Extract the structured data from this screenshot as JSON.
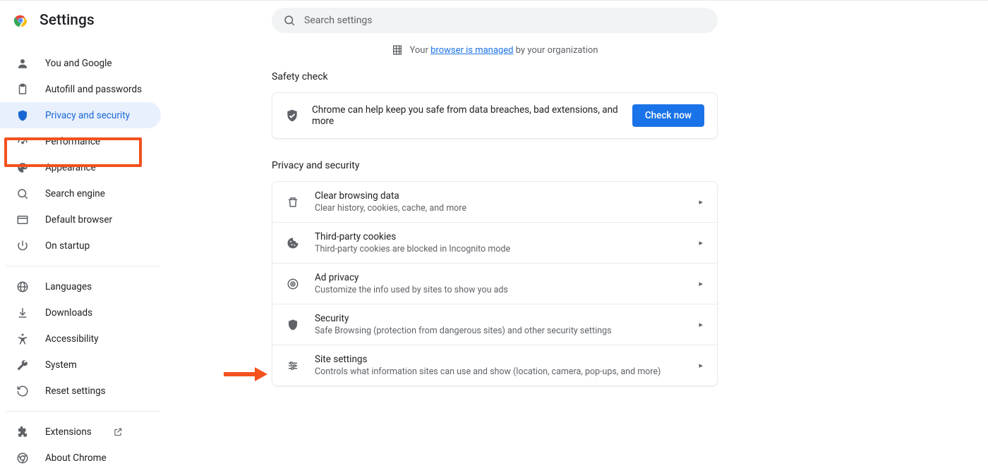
{
  "header": {
    "title": "Settings"
  },
  "search": {
    "placeholder": "Search settings"
  },
  "managed": {
    "pre": "Your ",
    "link": "browser is managed",
    "post": " by your organization"
  },
  "sidebar": {
    "primary": [
      {
        "label": "You and Google",
        "icon": "person"
      },
      {
        "label": "Autofill and passwords",
        "icon": "clipboard"
      },
      {
        "label": "Privacy and security",
        "icon": "shield",
        "active": true
      },
      {
        "label": "Performance",
        "icon": "speedometer"
      },
      {
        "label": "Appearance",
        "icon": "palette"
      },
      {
        "label": "Search engine",
        "icon": "search"
      },
      {
        "label": "Default browser",
        "icon": "browser"
      },
      {
        "label": "On startup",
        "icon": "power"
      }
    ],
    "secondary": [
      {
        "label": "Languages",
        "icon": "globe"
      },
      {
        "label": "Downloads",
        "icon": "download"
      },
      {
        "label": "Accessibility",
        "icon": "accessibility"
      },
      {
        "label": "System",
        "icon": "wrench"
      },
      {
        "label": "Reset settings",
        "icon": "reset"
      }
    ],
    "tertiary": [
      {
        "label": "Extensions",
        "icon": "extension",
        "external": true
      },
      {
        "label": "About Chrome",
        "icon": "chrome"
      }
    ]
  },
  "safety": {
    "section_title": "Safety check",
    "text": "Chrome can help keep you safe from data breaches, bad extensions, and more",
    "button": "Check now"
  },
  "privacy": {
    "section_title": "Privacy and security",
    "rows": [
      {
        "icon": "trash",
        "primary": "Clear browsing data",
        "secondary": "Clear history, cookies, cache, and more"
      },
      {
        "icon": "cookie",
        "primary": "Third-party cookies",
        "secondary": "Third-party cookies are blocked in Incognito mode"
      },
      {
        "icon": "adprivacy",
        "primary": "Ad privacy",
        "secondary": "Customize the info used by sites to show you ads"
      },
      {
        "icon": "shield",
        "primary": "Security",
        "secondary": "Safe Browsing (protection from dangerous sites) and other security settings"
      },
      {
        "icon": "sliders",
        "primary": "Site settings",
        "secondary": "Controls what information sites can use and show (location, camera, pop-ups, and more)"
      }
    ]
  }
}
